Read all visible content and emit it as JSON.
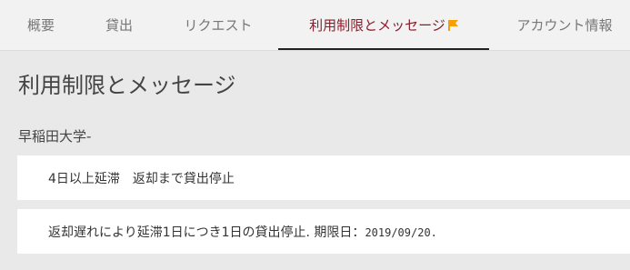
{
  "tabs": [
    {
      "label": "概要"
    },
    {
      "label": "貸出"
    },
    {
      "label": "リクエスト"
    },
    {
      "label": "利用制限とメッセージ"
    },
    {
      "label": "アカウント情報"
    }
  ],
  "accent_color": "#8a1c2b",
  "flag_color": "#f5a000",
  "page_title": "利用制限とメッセージ",
  "institution": "早稲田大学-",
  "messages": [
    {
      "text": "4日以上延滞　返却まで貸出停止"
    },
    {
      "text": "返却遅れにより延滞1日につき1日の貸出停止. 期限日：",
      "date": "2019/09/20."
    }
  ]
}
